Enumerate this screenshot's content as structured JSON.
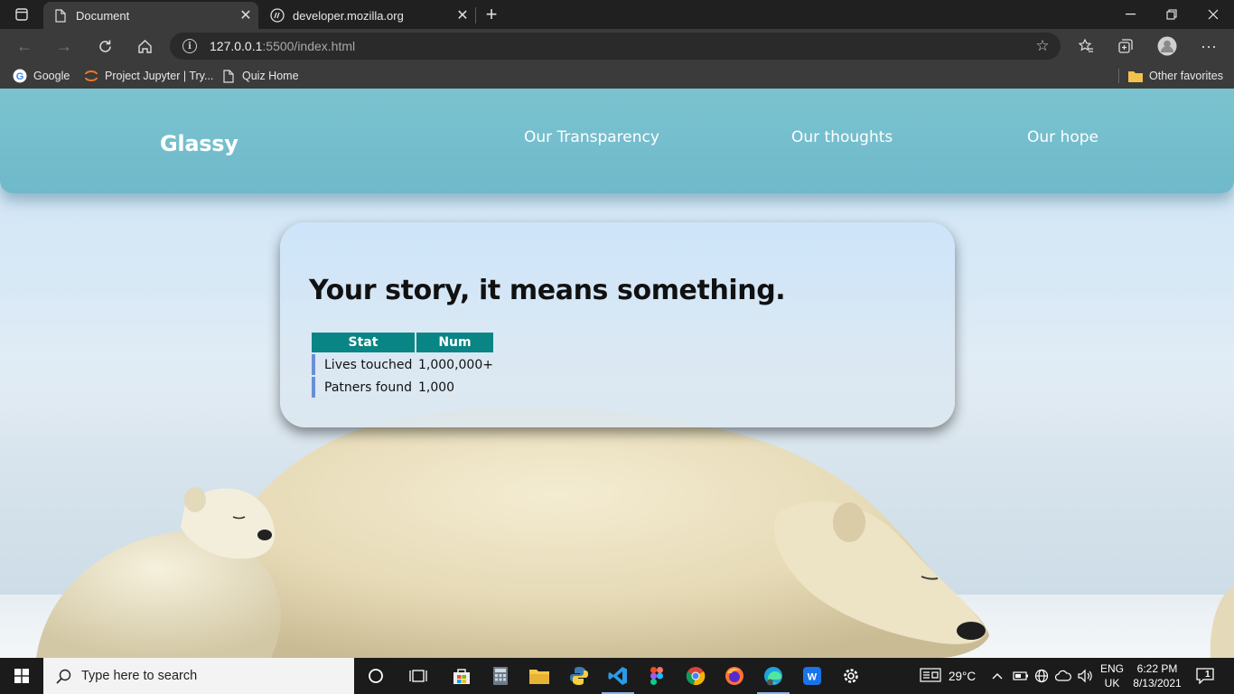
{
  "browser": {
    "tabs": [
      {
        "title": "Document",
        "active": true,
        "icon": "page-icon"
      },
      {
        "title": "developer.mozilla.org",
        "active": false,
        "icon": "mdn-icon"
      }
    ],
    "address": {
      "host": "127.0.0.1",
      "path": ":5500/index.html"
    },
    "bookmarks": [
      {
        "label": "Google",
        "icon": "google-icon"
      },
      {
        "label": "Project Jupyter | Try...",
        "icon": "jupyter-icon"
      },
      {
        "label": "Quiz Home",
        "icon": "page-icon"
      }
    ],
    "other_favorites": "Other favorites"
  },
  "page": {
    "brand": "Glassy",
    "nav": [
      "Our Transparency",
      "Our thoughts",
      "Our hope"
    ],
    "card": {
      "title": "Your story, it means something.",
      "table": {
        "headers": [
          "Stat",
          "Num"
        ],
        "rows": [
          [
            "Lives touched",
            "1,000,000+"
          ],
          [
            "Patners found",
            "1,000"
          ]
        ]
      }
    },
    "colors": {
      "navbar": "#72bccc",
      "table_header": "#0a8585",
      "row_marker": "#6a8fd6"
    }
  },
  "taskbar": {
    "search_placeholder": "Type here to search",
    "weather": "29°C",
    "lang": "ENG",
    "region": "UK",
    "time": "6:22 PM",
    "date": "8/13/2021",
    "notifications": "1"
  }
}
